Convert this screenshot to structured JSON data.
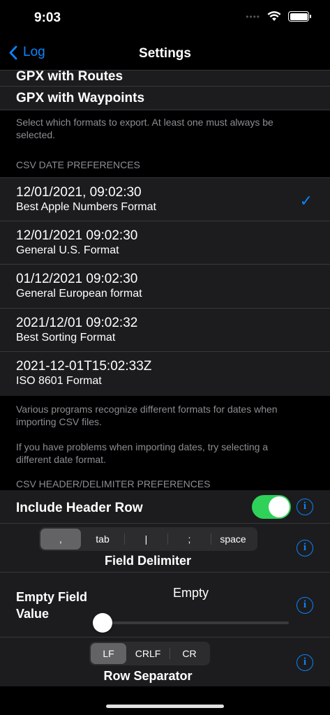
{
  "status_bar": {
    "time": "9:03",
    "signal": "••••"
  },
  "nav": {
    "back_label": "Log",
    "title": "Settings"
  },
  "export_formats": {
    "items": [
      "GPX with Routes",
      "GPX with Waypoints"
    ],
    "footer": "Select which formats to export. At least one must always be selected."
  },
  "csv_date": {
    "header": "CSV DATE PREFERENCES",
    "options": [
      {
        "value": "12/01/2021, 09:02:30",
        "desc": "Best Apple Numbers Format",
        "selected": true
      },
      {
        "value": "12/01/2021 09:02:30",
        "desc": "General U.S. Format",
        "selected": false
      },
      {
        "value": "01/12/2021 09:02:30",
        "desc": "General European format",
        "selected": false
      },
      {
        "value": "2021/12/01 09:02:32",
        "desc": "Best Sorting Format",
        "selected": false
      },
      {
        "value": "2021-12-01T15:02:33Z",
        "desc": "ISO 8601 Format",
        "selected": false
      }
    ],
    "checkmark": "✓",
    "footer1": "Various programs recognize different formats for dates when importing CSV files.",
    "footer2": "If you have problems when importing dates, try selecting a different date format."
  },
  "csv_header": {
    "header": "CSV HEADER/DELIMITER PREFERENCES",
    "include_header_label": "Include Header Row",
    "include_header_on": true,
    "delimiter_options": [
      ",",
      "tab",
      "|",
      ";",
      "space"
    ],
    "delimiter_selected": ",",
    "delimiter_label": "Field Delimiter",
    "empty_field_label": "Empty Field Value",
    "empty_field_value": "Empty",
    "empty_slider_value": 0,
    "row_sep_options": [
      "LF",
      "CRLF",
      "CR"
    ],
    "row_sep_selected": "LF",
    "row_sep_label": "Row Separator",
    "info_glyph": "i"
  },
  "colors": {
    "accent": "#0a84ff",
    "toggle_on": "#30d158",
    "cell_bg": "#1c1c1e"
  }
}
